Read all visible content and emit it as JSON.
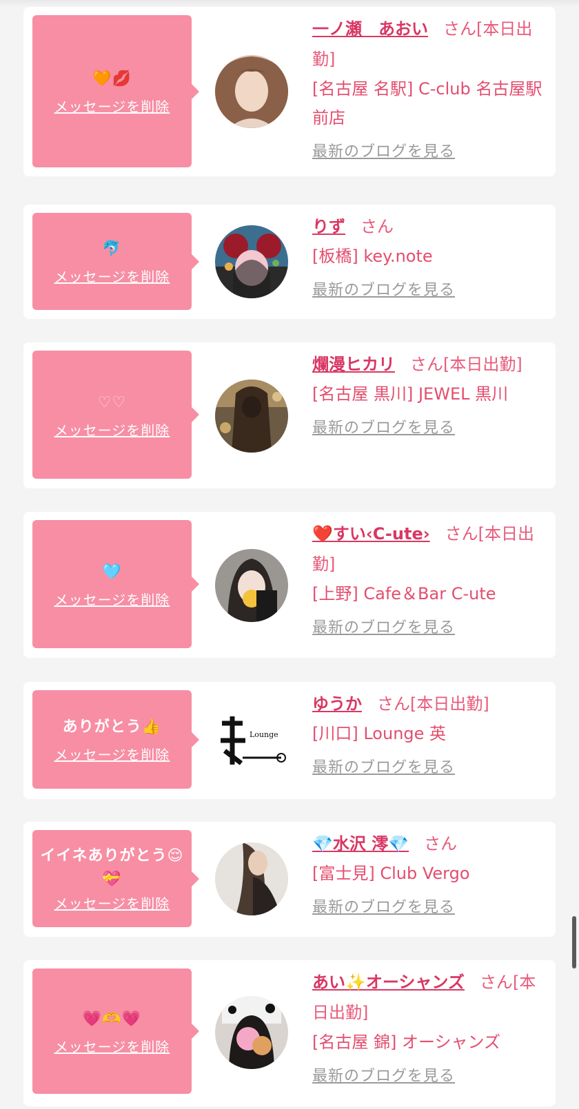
{
  "delete_label": "メッセージを削除",
  "blog_label": "最新のブログを見る",
  "san": "さん",
  "cards": [
    {
      "message": "🧡💋",
      "name": "一ノ瀬　あおい",
      "status": "[本日出勤]",
      "shop": "[名古屋 名駅] C-club 名古屋駅前店"
    },
    {
      "message": "🐬",
      "name": "りず",
      "status": "",
      "shop": "[板橋] key.note"
    },
    {
      "message": "♡♡",
      "name": "爛漫ヒカリ",
      "status": "[本日出勤]",
      "shop": "[名古屋 黒川] JEWEL 黒川"
    },
    {
      "message": "🩵",
      "name": "❤️すい‹C-ute›",
      "status": "[本日出勤]",
      "shop": "[上野] Cafe＆Bar C-ute"
    },
    {
      "message": "ありがとう👍",
      "name": "ゆうか",
      "status": "[本日出勤]",
      "shop": "[川口] Lounge 英"
    },
    {
      "message": "イイネありがとう😌💝",
      "name": "💎水沢 澪💎",
      "status": "",
      "shop": "[富士見] Club Vergo"
    },
    {
      "message": "💗🫶💗",
      "name": "あい✨オーシャンズ",
      "status": "[本日出勤]",
      "shop": "[名古屋 錦] オーシャンズ"
    }
  ],
  "colors": {
    "bubble": "#f78ea4",
    "name": "#d93763",
    "shop": "#e44d6e",
    "blog": "#9a9a9a"
  }
}
